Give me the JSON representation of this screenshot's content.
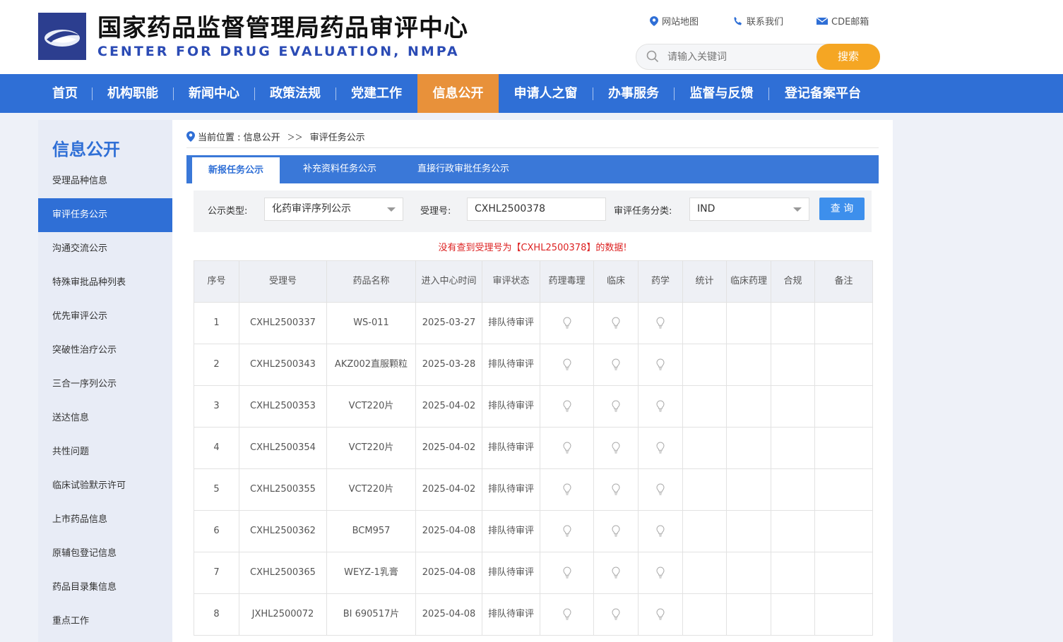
{
  "header": {
    "title_cn": "国家药品监督管理局药品审评中心",
    "title_en": "CENTER FOR DRUG EVALUATION, NMPA",
    "links": [
      "网站地图",
      "联系我们",
      "CDE邮箱"
    ],
    "search_placeholder": "请输入关键词",
    "search_button": "搜索"
  },
  "nav": {
    "items": [
      "首页",
      "机构职能",
      "新闻中心",
      "政策法规",
      "党建工作",
      "信息公开",
      "申请人之窗",
      "办事服务",
      "监督与反馈",
      "登记备案平台"
    ],
    "active": "信息公开"
  },
  "sidebar": {
    "title": "信息公开",
    "items": [
      "受理品种信息",
      "审评任务公示",
      "沟通交流公示",
      "特殊审批品种列表",
      "优先审评公示",
      "突破性治疗公示",
      "三合一序列公示",
      "送达信息",
      "共性问题",
      "临床试验默示许可",
      "上市药品信息",
      "原辅包登记信息",
      "药品目录集信息",
      "重点工作"
    ],
    "active": "审评任务公示"
  },
  "breadcrumb": {
    "prefix": "当前位置 : 信息公开",
    "sep": "＞＞",
    "current": "审评任务公示"
  },
  "tabs": [
    "新报任务公示",
    "补充资料任务公示",
    "直接行政审批任务公示"
  ],
  "filter": {
    "type_label": "公示类型:",
    "type_value": "化药审评序列公示",
    "acceptance_label": "受理号:",
    "acceptance_value": "CXHL2500378",
    "category_label": "审评任务分类:",
    "category_value": "IND",
    "query_button": "查 询"
  },
  "notice": "没有查到受理号为【CXHL2500378】的数据!",
  "table": {
    "headers": [
      "序号",
      "受理号",
      "药品名称",
      "进入中心时间",
      "审评状态",
      "药理毒理",
      "临床",
      "药学",
      "统计",
      "临床药理",
      "合规",
      "备注"
    ],
    "rows": [
      {
        "no": "1",
        "id": "CXHL2500337",
        "name": "WS-011",
        "date": "2025-03-27",
        "status": "排队待审评"
      },
      {
        "no": "2",
        "id": "CXHL2500343",
        "name": "AKZ002直服颗粒",
        "date": "2025-03-28",
        "status": "排队待审评"
      },
      {
        "no": "3",
        "id": "CXHL2500353",
        "name": "VCT220片",
        "date": "2025-04-02",
        "status": "排队待审评"
      },
      {
        "no": "4",
        "id": "CXHL2500354",
        "name": "VCT220片",
        "date": "2025-04-02",
        "status": "排队待审评"
      },
      {
        "no": "5",
        "id": "CXHL2500355",
        "name": "VCT220片",
        "date": "2025-04-02",
        "status": "排队待审评"
      },
      {
        "no": "6",
        "id": "CXHL2500362",
        "name": "BCM957",
        "date": "2025-04-08",
        "status": "排队待审评"
      },
      {
        "no": "7",
        "id": "CXHL2500365",
        "name": "WEYZ-1乳膏",
        "date": "2025-04-08",
        "status": "排队待审评"
      },
      {
        "no": "8",
        "id": "JXHL2500072",
        "name": "BI 690517片",
        "date": "2025-04-08",
        "status": "排队待审评"
      }
    ]
  },
  "colors": {
    "nav_blue": "#2f6fd6",
    "nav_active": "#e8913a",
    "search_button": "#f5a623",
    "notice_red": "#dd2222"
  }
}
